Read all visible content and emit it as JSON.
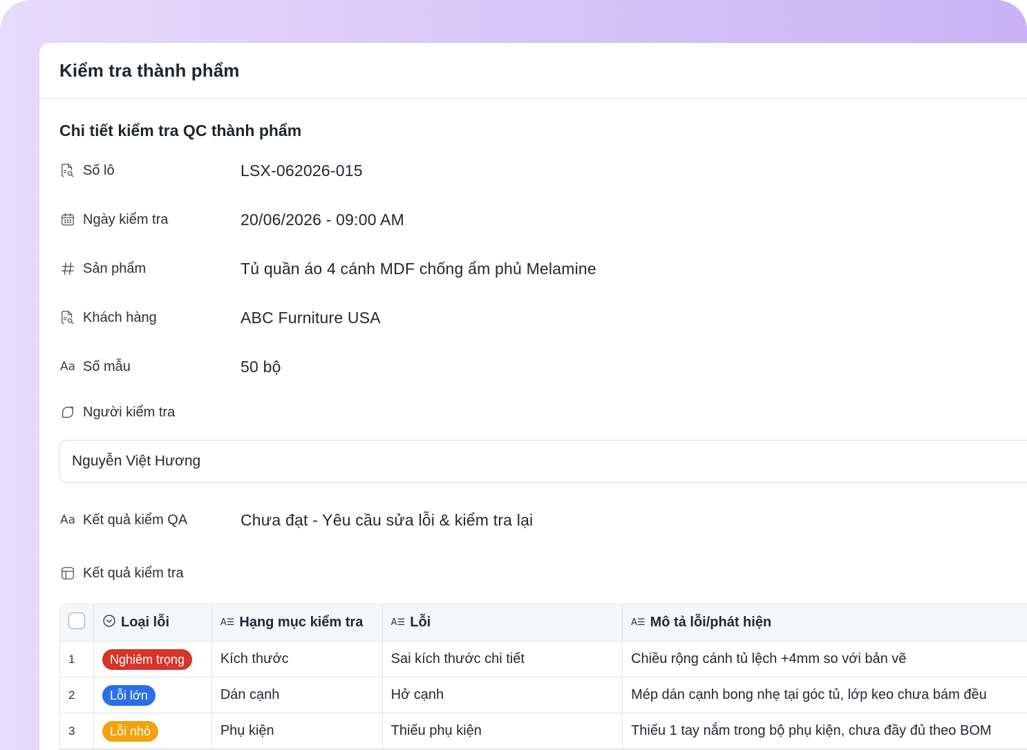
{
  "page": {
    "title": "Kiểm tra thành phẩm",
    "section_title": "Chi tiết kiểm tra QC thành phẩm"
  },
  "fields": {
    "lot": {
      "label": "Số lô",
      "value": "LSX-062026-015",
      "icon": "document-search-icon"
    },
    "date": {
      "label": "Ngày kiểm tra",
      "value": "20/06/2026 - 09:00 AM",
      "icon": "calendar-icon"
    },
    "product": {
      "label": "Sản phẩm",
      "value": "Tủ quần áo 4 cánh MDF chống ẩm phủ Melamine",
      "icon": "hash-icon"
    },
    "customer": {
      "label": "Khách hàng",
      "value": "ABC Furniture USA",
      "icon": "document-search-icon"
    },
    "samples": {
      "label": "Số mẫu",
      "value": "50 bộ",
      "icon": "text-icon"
    },
    "inspector": {
      "label": "Người kiểm tra",
      "value": "Nguyễn Việt Hương",
      "icon": "user-shape-icon"
    },
    "qa_result": {
      "label": "Kết quả kiểm QA",
      "value": "Chưa đạt - Yêu cầu sửa lỗi & kiểm tra lại",
      "icon": "text-icon"
    },
    "results_table": {
      "label": "Kết quả kiểm tra",
      "icon": "table-icon"
    }
  },
  "table": {
    "columns": {
      "type": "Loại lỗi",
      "category": "Hạng mục kiểm tra",
      "defect": "Lỗi",
      "description": "Mô tả lỗi/phát hiện"
    },
    "rows": [
      {
        "index": "1",
        "type": "Nghiêm trọng",
        "type_color": "#d7342a",
        "category": "Kích thước",
        "defect": "Sai kích thước chi tiết",
        "description": "Chiều rộng cánh tủ lệch +4mm so với bản vẽ"
      },
      {
        "index": "2",
        "type": "Lỗi lớn",
        "type_color": "#2b6fe8",
        "category": "Dán cạnh",
        "defect": "Hở cạnh",
        "description": "Mép dán cạnh bong nhẹ tại góc tủ, lớp keo chưa bám đều"
      },
      {
        "index": "3",
        "type": "Lỗi nhỏ",
        "type_color": "#f2a20c",
        "category": "Phụ kiện",
        "defect": "Thiếu phụ kiện",
        "description": "Thiếu 1 tay nắm trong bộ phụ kiện, chưa đầy đủ theo BOM"
      }
    ]
  }
}
